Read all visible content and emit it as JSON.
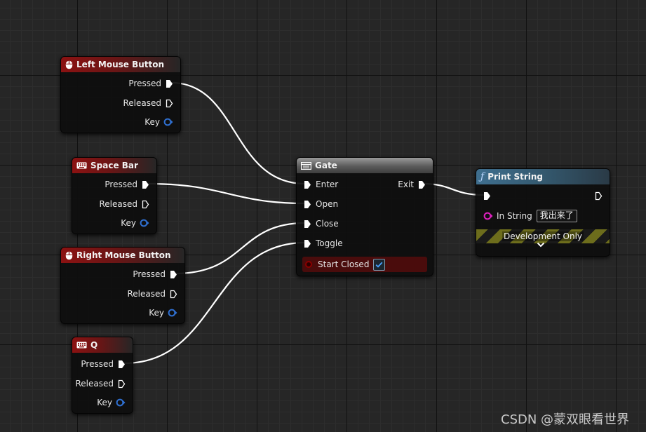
{
  "nodes": {
    "lmb": {
      "title": "Left Mouse Button",
      "icon": "mouse-icon",
      "pins": [
        "Pressed",
        "Released",
        "Key"
      ]
    },
    "space": {
      "title": "Space Bar",
      "icon": "keyboard-icon",
      "pins": [
        "Pressed",
        "Released",
        "Key"
      ]
    },
    "rmb": {
      "title": "Right Mouse Button",
      "icon": "mouse-icon",
      "pins": [
        "Pressed",
        "Released",
        "Key"
      ]
    },
    "q": {
      "title": "Q",
      "icon": "keyboard-icon",
      "pins": [
        "Pressed",
        "Released",
        "Key"
      ]
    },
    "gate": {
      "title": "Gate",
      "icon": "gate-icon",
      "inputs": [
        "Enter",
        "Open",
        "Close",
        "Toggle"
      ],
      "output": "Exit",
      "start_closed_label": "Start Closed",
      "start_closed_checked": true
    },
    "print": {
      "title": "Print String",
      "icon": "function-icon",
      "in_string_label": "In String",
      "in_string_value": "我出来了",
      "dev_label": "Development Only"
    }
  },
  "colors": {
    "event_header": "#8c1212",
    "gate_header": "#6a6a6a",
    "function_header": "#3f6f8f",
    "key_pin": "#2f6fd0",
    "string_pin": "#e020c0",
    "bool_pin": "#8b0000",
    "wire": "#ffffff"
  },
  "watermark": "CSDN @蒙双眼看世界"
}
